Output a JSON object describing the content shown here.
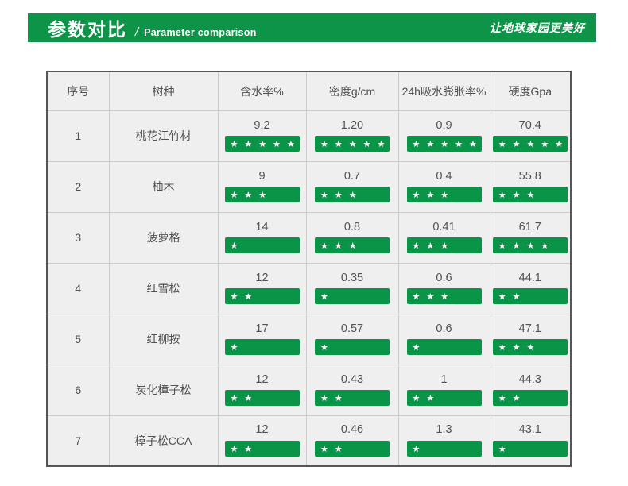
{
  "banner": {
    "title_cn": "参数对比",
    "separator": "/",
    "title_en": "Parameter comparison",
    "slogan": "让地球家园更美好",
    "bg_color": "#0e9448"
  },
  "colors": {
    "banner_green": "#0e9448",
    "bar_green": "#0a9447",
    "cell_background": "#efefef",
    "outer_border": "#55565a",
    "inner_border": "#cbcbcb",
    "text": "#515151",
    "star": "#ffffff"
  },
  "star_icon": "★",
  "chart_data": {
    "type": "table",
    "title": "参数对比 / Parameter comparison",
    "columns": [
      "序号",
      "树种",
      "含水率%",
      "密度g/cm",
      "24h吸水膨胀率%",
      "硬度Gpa"
    ],
    "max_stars": 5,
    "rows": [
      {
        "no": "1",
        "species": "桃花江竹材",
        "metrics": [
          {
            "value": "9.2",
            "stars": 5
          },
          {
            "value": "1.20",
            "stars": 5
          },
          {
            "value": "0.9",
            "stars": 5
          },
          {
            "value": "70.4",
            "stars": 5
          }
        ]
      },
      {
        "no": "2",
        "species": "柚木",
        "metrics": [
          {
            "value": "9",
            "stars": 3
          },
          {
            "value": "0.7",
            "stars": 3
          },
          {
            "value": "0.4",
            "stars": 3
          },
          {
            "value": "55.8",
            "stars": 3
          }
        ]
      },
      {
        "no": "3",
        "species": "菠萝格",
        "metrics": [
          {
            "value": "14",
            "stars": 1
          },
          {
            "value": "0.8",
            "stars": 3
          },
          {
            "value": "0.41",
            "stars": 3
          },
          {
            "value": "61.7",
            "stars": 4
          }
        ]
      },
      {
        "no": "4",
        "species": "红雪松",
        "metrics": [
          {
            "value": "12",
            "stars": 2
          },
          {
            "value": "0.35",
            "stars": 1
          },
          {
            "value": "0.6",
            "stars": 3
          },
          {
            "value": "44.1",
            "stars": 2
          }
        ]
      },
      {
        "no": "5",
        "species": "红柳按",
        "metrics": [
          {
            "value": "17",
            "stars": 1
          },
          {
            "value": "0.57",
            "stars": 1
          },
          {
            "value": "0.6",
            "stars": 1
          },
          {
            "value": "47.1",
            "stars": 3
          }
        ]
      },
      {
        "no": "6",
        "species": "炭化樟子松",
        "metrics": [
          {
            "value": "12",
            "stars": 2
          },
          {
            "value": "0.43",
            "stars": 2
          },
          {
            "value": "1",
            "stars": 2
          },
          {
            "value": "44.3",
            "stars": 2
          }
        ]
      },
      {
        "no": "7",
        "species": "樟子松CCA",
        "metrics": [
          {
            "value": "12",
            "stars": 2
          },
          {
            "value": "0.46",
            "stars": 2
          },
          {
            "value": "1.3",
            "stars": 1
          },
          {
            "value": "43.1",
            "stars": 1
          }
        ]
      }
    ]
  }
}
